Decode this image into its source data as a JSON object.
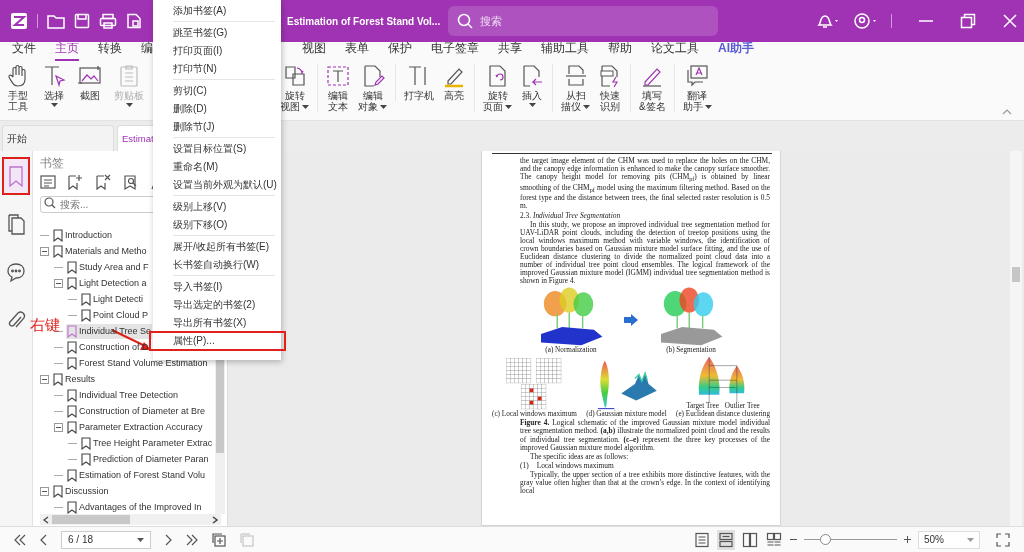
{
  "title_bar": {
    "title": "Estimation of Forest Stand Vol...",
    "search": {
      "placeholder": "搜索"
    }
  },
  "menu_tabs": [
    {
      "label": "文件",
      "selected": false
    },
    {
      "label": "主页",
      "selected": true
    },
    {
      "label": "转换",
      "selected": false
    },
    {
      "label": "编",
      "selected": false
    },
    {
      "label": "视图",
      "selected": false
    },
    {
      "label": "表单",
      "selected": false
    },
    {
      "label": "保护",
      "selected": false
    },
    {
      "label": "电子签章",
      "selected": false
    },
    {
      "label": "共享",
      "selected": false
    },
    {
      "label": "辅助工具",
      "selected": false
    },
    {
      "label": "帮助",
      "selected": false
    },
    {
      "label": "论文工具",
      "selected": false
    },
    {
      "label": "AI助手",
      "selected": false,
      "kind": "ai"
    }
  ],
  "ribbon": {
    "groups": [
      [
        {
          "lines": [
            "手型",
            "工具"
          ],
          "dropdown": false,
          "disabled": false
        },
        {
          "lines": [
            "选择"
          ],
          "dropdown": true,
          "disabled": false
        },
        {
          "lines": [
            "截图"
          ],
          "dropdown": false,
          "disabled": false
        },
        {
          "lines": [
            "剪贴板"
          ],
          "dropdown": true,
          "disabled": true
        }
      ],
      [
        {
          "lines": [
            "旋转",
            "视图"
          ],
          "dropdown": true,
          "disabled": false
        }
      ],
      [
        {
          "lines": [
            "编辑",
            "文本"
          ],
          "dropdown": false,
          "disabled": false
        },
        {
          "lines": [
            "编辑",
            "对象"
          ],
          "dropdown": true,
          "disabled": false
        }
      ],
      [
        {
          "lines": [
            "打字机"
          ],
          "dropdown": false,
          "disabled": false
        },
        {
          "lines": [
            "高亮"
          ],
          "dropdown": false,
          "disabled": false
        }
      ],
      [
        {
          "lines": [
            "旋转",
            "页面"
          ],
          "dropdown": true,
          "disabled": false
        },
        {
          "lines": [
            "插入"
          ],
          "dropdown": true,
          "disabled": false
        }
      ],
      [
        {
          "lines": [
            "从扫",
            "描仪"
          ],
          "dropdown": true,
          "disabled": false
        },
        {
          "lines": [
            "快速",
            "识别"
          ],
          "dropdown": false,
          "disabled": false
        }
      ],
      [
        {
          "lines": [
            "填写",
            "&签名"
          ],
          "dropdown": false,
          "disabled": false
        }
      ],
      [
        {
          "lines": [
            "翻译",
            "助手"
          ],
          "dropdown": true,
          "disabled": false
        }
      ]
    ]
  },
  "doc_tabs": [
    {
      "label": "开始",
      "selected": false
    },
    {
      "label": "Estimat",
      "selected": true
    }
  ],
  "side_icons": [
    {
      "selected": true,
      "marked": true
    },
    {
      "selected": false,
      "marked": false
    },
    {
      "selected": false,
      "marked": false
    },
    {
      "selected": false,
      "marked": false
    }
  ],
  "bookmarks": {
    "title": "书签",
    "search": {
      "placeholder": "搜索..."
    },
    "tree": [
      {
        "label": "Introduction",
        "selected": false
      },
      {
        "label": "Materials and Metho",
        "selected": false,
        "expanded": true,
        "children": [
          {
            "label": "Study Area and F",
            "selected": false
          },
          {
            "label": "Light Detection a",
            "selected": false,
            "expanded": true,
            "children": [
              {
                "label": "Light Detecti",
                "selected": false
              },
              {
                "label": "Point Cloud P",
                "selected": false
              }
            ]
          },
          {
            "label": "Individual Tree Se",
            "selected": true
          },
          {
            "label": "Construction of D",
            "selected": false
          },
          {
            "label": "Forest Stand Volume Estimation",
            "selected": false
          }
        ]
      },
      {
        "label": "Results",
        "selected": false,
        "expanded": true,
        "children": [
          {
            "label": "Individual Tree Detection",
            "selected": false
          },
          {
            "label": "Construction of Diameter at Bre",
            "selected": false
          },
          {
            "label": "Parameter Extraction Accuracy",
            "selected": false,
            "expanded": true,
            "children": [
              {
                "label": "Tree Height Parameter Extrac",
                "selected": false
              },
              {
                "label": "Prediction of Diameter Paran",
                "selected": false
              }
            ]
          },
          {
            "label": "Estimation of Forest Stand Volu",
            "selected": false
          }
        ]
      },
      {
        "label": "Discussion",
        "selected": false,
        "expanded": true,
        "children": [
          {
            "label": "Advantages of the Improved In",
            "selected": false
          }
        ]
      }
    ]
  },
  "context_menu": {
    "groups": [
      [
        {
          "label": "添加书签(A)",
          "marked": false
        }
      ],
      [
        {
          "label": "跳至书签(G)",
          "marked": false
        },
        {
          "label": "打印页面(I)",
          "marked": false
        },
        {
          "label": "打印节(N)",
          "marked": false
        }
      ],
      [
        {
          "label": "剪切(C)",
          "marked": false
        },
        {
          "label": "删除(D)",
          "marked": false
        },
        {
          "label": "删除节(J)",
          "marked": false
        }
      ],
      [
        {
          "label": "设置目标位置(S)",
          "marked": false
        },
        {
          "label": "重命名(M)",
          "marked": false
        },
        {
          "label": "设置当前外观为默认(U)",
          "marked": false
        }
      ],
      [
        {
          "label": "级别上移(V)",
          "marked": false
        },
        {
          "label": "级别下移(O)",
          "marked": false
        }
      ],
      [
        {
          "label": "展开/收起所有书签(E)",
          "marked": false
        },
        {
          "label": "长书签自动换行(W)",
          "marked": false
        }
      ],
      [
        {
          "label": "导入书签(I)",
          "marked": false
        },
        {
          "label": "导出选定的书签(2)",
          "marked": false
        },
        {
          "label": "导出所有书签(X)",
          "marked": false
        },
        {
          "label": "属性(P)...",
          "marked": true
        }
      ]
    ]
  },
  "annotation": {
    "label": "右键"
  },
  "document": {
    "paragraphs_top": [
      "the target image element of the CHM was used to replace the holes on the CHM, and the canopy edge information is enhanced to make the canopy surface smoother. The canopy height model for removing pits (CHM$_{pf}$) is obtained by linear smoothing of the CHM$_{pf}$ model using the maximum filtering method. Based on the forest type and the distance between trees, the final selected raster resolution is 0.5 m."
    ],
    "heading": "2.3. *Individual Tree Segmentation*",
    "paragraphs": [
      "In this study, we propose an improved individual tree segmentation method for UAV-LiDAR point clouds, including the detection of treetop positions using the local windows maximum method with variable windows, the identification of crown boundaries based on Gaussian mixture model surface fitting, and the use of Euclidean distance clustering to divide the normalized point cloud data into a number of individual tree point cloud ensembles. The logical framework of the improved Gaussian mixture model (IGMM) individual tree segmentation method is shown in Figure 4."
    ],
    "figure": {
      "captions": [
        "(a) Normalization",
        "(b) Segmentation",
        "(c) Local windows maximum",
        "(d) Gaussian mixture model",
        "(e) Euclidean distance clustering"
      ],
      "tree_labels": [
        "Target Tree",
        "Outlier Tree"
      ],
      "caption": "**Figure 4.** Logical schematic of the improved Gaussian mixture model individual tree segmentation method. **(a,b)** illustrate the normalized point cloud and the results of individual tree segmentation. **(c–e)** represent the three key processes of the improved Gaussian mixture model algorithm."
    },
    "after": [
      {
        "kind": "para",
        "text": "The specific ideas are as follows:"
      },
      {
        "kind": "item",
        "number": "(1)",
        "text": "Local windows maximum"
      },
      {
        "kind": "para",
        "text": "Typically, the upper section of a tree exhibits more distinctive features, with the gray value often higher than that at the crown’s edge. In the context of identifying local"
      }
    ]
  },
  "status_bar": {
    "page": "6 / 18",
    "view_modes": [
      {
        "selected": false
      },
      {
        "selected": true
      },
      {
        "selected": false
      },
      {
        "selected": false
      }
    ],
    "zoom": {
      "level": 0.23,
      "value": "50%"
    }
  }
}
